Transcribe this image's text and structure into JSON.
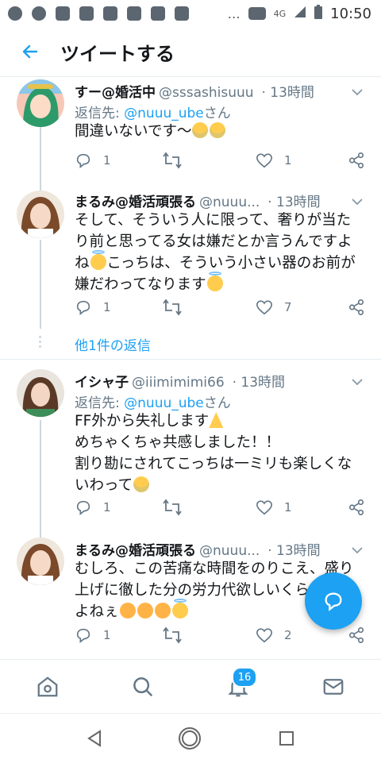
{
  "status_bar": {
    "time": "10:50",
    "network": "4G",
    "overflow": "…",
    "left_icons": [
      "music-icon",
      "add-app-icon",
      "tv-icon",
      "radio-icon",
      "twitch-icon",
      "youtube-icon",
      "youtube-icon",
      "youtube-icon"
    ]
  },
  "header": {
    "title": "ツイートする",
    "back_icon": "back-arrow-icon"
  },
  "tweets": [
    {
      "name": "すー@婚活中",
      "handle": "@sssashisuuu",
      "time": "· 13時間",
      "reply_prefix": "返信先: ",
      "reply_mention": "@nuuu_ube",
      "reply_suffix": "さん",
      "lines": [
        "間違いないです〜"
      ],
      "replies": "1",
      "retweets": "",
      "likes": "1"
    },
    {
      "name": "まるみ@婚活頑張る",
      "handle": "@nuuu...",
      "time": "· 13時間",
      "lines": [
        "そして、そういう人に限って、奢りが当た",
        "り前と思ってる女は嫌だとか言うんですよ",
        "ね",
        "こっちは、そういう小さい器のお前が",
        "嫌だわってなります"
      ],
      "replies": "1",
      "retweets": "",
      "likes": "7"
    },
    {
      "name": "イシャ子",
      "handle": "@iiimimimi66",
      "time": "· 13時間",
      "reply_prefix": "返信先: ",
      "reply_mention": "@nuuu_ube",
      "reply_suffix": "さん",
      "lines": [
        "FF外から失礼します",
        "めちゃくちゃ共感しました！！",
        "割り勘にされてこっちは一ミリも楽しくな",
        "いわって"
      ],
      "replies": "1",
      "retweets": "",
      "likes": "1"
    },
    {
      "name": "まるみ@婚活頑張る",
      "handle": "@nuuu...",
      "time": "· 13時間",
      "lines": [
        "むしろ、この苦痛な時間をのりこえ、盛り",
        "上げに徹した分の労力代欲しいくらいです",
        "よねぇ"
      ],
      "replies": "1",
      "retweets": "",
      "likes": "2"
    }
  ],
  "more_replies": "他1件の返信",
  "bottom_nav": {
    "notification_count": "16",
    "items": [
      "home-icon",
      "search-icon",
      "notifications-icon",
      "messages-icon"
    ]
  },
  "colors": {
    "accent": "#1da1f2",
    "secondary_text": "#657786",
    "divider": "#e6ecf0"
  }
}
